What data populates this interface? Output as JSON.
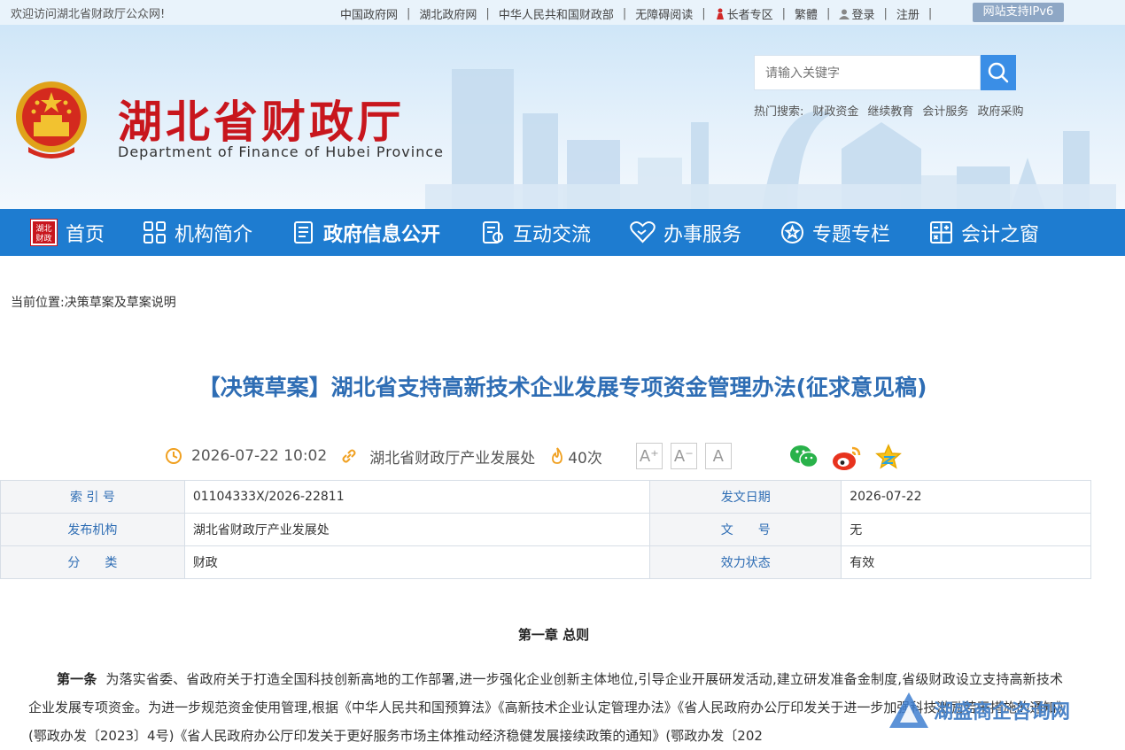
{
  "topbar": {
    "welcome": "欢迎访问湖北省财政厅公众网!",
    "links": [
      "中国政府网",
      "湖北政府网",
      "中华人民共和国财政部",
      "无障碍阅读",
      "长者专区",
      "繁體",
      "登录",
      "注册"
    ],
    "ipv6": "网站支持IPv6"
  },
  "header": {
    "title": "湖北省财政厅",
    "subtitle": "Department of Finance of Hubei Province",
    "search_placeholder": "请输入关键字",
    "hot_label": "热门搜索:",
    "hot_terms": [
      "财政资金",
      "继续教育",
      "会计服务",
      "政府采购"
    ]
  },
  "nav": {
    "logo_text": "湖北财政",
    "items": [
      "首页",
      "机构简介",
      "政府信息公开",
      "互动交流",
      "办事服务",
      "专题专栏",
      "会计之窗"
    ]
  },
  "breadcrumb": "当前位置:决策草案及草案说明",
  "article": {
    "title": "【决策草案】湖北省支持高新技术企业发展专项资金管理办法(征求意见稿)",
    "datetime": "2026-07-22 10:02",
    "source": "湖北省财政厅产业发展处",
    "views": "40次",
    "font_buttons": [
      "A⁺",
      "A⁻",
      "A"
    ]
  },
  "info_table": [
    [
      {
        "label": "索 引 号",
        "value": "01104333X/2026-22811"
      },
      {
        "label": "发文日期",
        "value": "2026-07-22"
      }
    ],
    [
      {
        "label": "发布机构",
        "value": "湖北省财政厅产业发展处"
      },
      {
        "label": "文　　号",
        "value": "无"
      }
    ],
    [
      {
        "label": "分　　类",
        "value": "财政"
      },
      {
        "label": "效力状态",
        "value": "有效"
      }
    ]
  ],
  "content": {
    "chapter": "第一章 总则",
    "article_label": "第一条",
    "paragraph": "为落实省委、省政府关于打造全国科技创新高地的工作部署,进一步强化企业创新主体地位,引导企业开展研发活动,建立研发准备金制度,省级财政设立支持高新技术企业发展专项资金。为进一步规范资金使用管理,根据《中华人民共和国预算法》《高新技术企业认定管理办法》《省人民政府办公厅印发关于进一步加强科技激励若干措施的通知》(鄂政办发〔2023〕4号)《省人民政府办公厅印发关于更好服务市场主体推动经济稳健发展接续政策的通知》(鄂政办发〔202"
  },
  "watermark": "湖盛商企咨询网",
  "colors": {
    "nav_bg": "#1e7cd0",
    "title_red": "#c8161d",
    "article_title": "#2e6db4",
    "accent_orange": "#f0a020"
  }
}
